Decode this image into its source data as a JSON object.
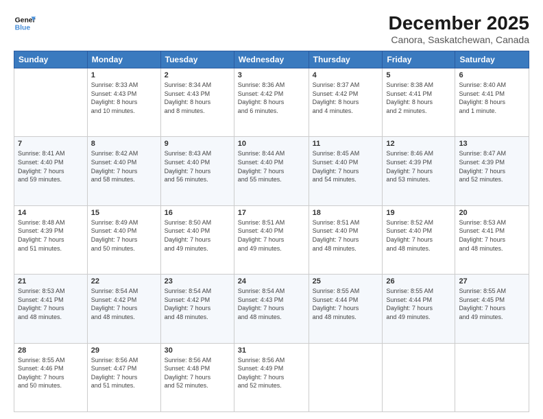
{
  "logo": {
    "line1": "General",
    "line2": "Blue"
  },
  "title": "December 2025",
  "subtitle": "Canora, Saskatchewan, Canada",
  "header_days": [
    "Sunday",
    "Monday",
    "Tuesday",
    "Wednesday",
    "Thursday",
    "Friday",
    "Saturday"
  ],
  "weeks": [
    [
      {
        "day": "",
        "content": ""
      },
      {
        "day": "1",
        "content": "Sunrise: 8:33 AM\nSunset: 4:43 PM\nDaylight: 8 hours\nand 10 minutes."
      },
      {
        "day": "2",
        "content": "Sunrise: 8:34 AM\nSunset: 4:43 PM\nDaylight: 8 hours\nand 8 minutes."
      },
      {
        "day": "3",
        "content": "Sunrise: 8:36 AM\nSunset: 4:42 PM\nDaylight: 8 hours\nand 6 minutes."
      },
      {
        "day": "4",
        "content": "Sunrise: 8:37 AM\nSunset: 4:42 PM\nDaylight: 8 hours\nand 4 minutes."
      },
      {
        "day": "5",
        "content": "Sunrise: 8:38 AM\nSunset: 4:41 PM\nDaylight: 8 hours\nand 2 minutes."
      },
      {
        "day": "6",
        "content": "Sunrise: 8:40 AM\nSunset: 4:41 PM\nDaylight: 8 hours\nand 1 minute."
      }
    ],
    [
      {
        "day": "7",
        "content": "Sunrise: 8:41 AM\nSunset: 4:40 PM\nDaylight: 7 hours\nand 59 minutes."
      },
      {
        "day": "8",
        "content": "Sunrise: 8:42 AM\nSunset: 4:40 PM\nDaylight: 7 hours\nand 58 minutes."
      },
      {
        "day": "9",
        "content": "Sunrise: 8:43 AM\nSunset: 4:40 PM\nDaylight: 7 hours\nand 56 minutes."
      },
      {
        "day": "10",
        "content": "Sunrise: 8:44 AM\nSunset: 4:40 PM\nDaylight: 7 hours\nand 55 minutes."
      },
      {
        "day": "11",
        "content": "Sunrise: 8:45 AM\nSunset: 4:40 PM\nDaylight: 7 hours\nand 54 minutes."
      },
      {
        "day": "12",
        "content": "Sunrise: 8:46 AM\nSunset: 4:39 PM\nDaylight: 7 hours\nand 53 minutes."
      },
      {
        "day": "13",
        "content": "Sunrise: 8:47 AM\nSunset: 4:39 PM\nDaylight: 7 hours\nand 52 minutes."
      }
    ],
    [
      {
        "day": "14",
        "content": "Sunrise: 8:48 AM\nSunset: 4:39 PM\nDaylight: 7 hours\nand 51 minutes."
      },
      {
        "day": "15",
        "content": "Sunrise: 8:49 AM\nSunset: 4:40 PM\nDaylight: 7 hours\nand 50 minutes."
      },
      {
        "day": "16",
        "content": "Sunrise: 8:50 AM\nSunset: 4:40 PM\nDaylight: 7 hours\nand 49 minutes."
      },
      {
        "day": "17",
        "content": "Sunrise: 8:51 AM\nSunset: 4:40 PM\nDaylight: 7 hours\nand 49 minutes."
      },
      {
        "day": "18",
        "content": "Sunrise: 8:51 AM\nSunset: 4:40 PM\nDaylight: 7 hours\nand 48 minutes."
      },
      {
        "day": "19",
        "content": "Sunrise: 8:52 AM\nSunset: 4:40 PM\nDaylight: 7 hours\nand 48 minutes."
      },
      {
        "day": "20",
        "content": "Sunrise: 8:53 AM\nSunset: 4:41 PM\nDaylight: 7 hours\nand 48 minutes."
      }
    ],
    [
      {
        "day": "21",
        "content": "Sunrise: 8:53 AM\nSunset: 4:41 PM\nDaylight: 7 hours\nand 48 minutes."
      },
      {
        "day": "22",
        "content": "Sunrise: 8:54 AM\nSunset: 4:42 PM\nDaylight: 7 hours\nand 48 minutes."
      },
      {
        "day": "23",
        "content": "Sunrise: 8:54 AM\nSunset: 4:42 PM\nDaylight: 7 hours\nand 48 minutes."
      },
      {
        "day": "24",
        "content": "Sunrise: 8:54 AM\nSunset: 4:43 PM\nDaylight: 7 hours\nand 48 minutes."
      },
      {
        "day": "25",
        "content": "Sunrise: 8:55 AM\nSunset: 4:44 PM\nDaylight: 7 hours\nand 48 minutes."
      },
      {
        "day": "26",
        "content": "Sunrise: 8:55 AM\nSunset: 4:44 PM\nDaylight: 7 hours\nand 49 minutes."
      },
      {
        "day": "27",
        "content": "Sunrise: 8:55 AM\nSunset: 4:45 PM\nDaylight: 7 hours\nand 49 minutes."
      }
    ],
    [
      {
        "day": "28",
        "content": "Sunrise: 8:55 AM\nSunset: 4:46 PM\nDaylight: 7 hours\nand 50 minutes."
      },
      {
        "day": "29",
        "content": "Sunrise: 8:56 AM\nSunset: 4:47 PM\nDaylight: 7 hours\nand 51 minutes."
      },
      {
        "day": "30",
        "content": "Sunrise: 8:56 AM\nSunset: 4:48 PM\nDaylight: 7 hours\nand 52 minutes."
      },
      {
        "day": "31",
        "content": "Sunrise: 8:56 AM\nSunset: 4:49 PM\nDaylight: 7 hours\nand 52 minutes."
      },
      {
        "day": "",
        "content": ""
      },
      {
        "day": "",
        "content": ""
      },
      {
        "day": "",
        "content": ""
      }
    ]
  ],
  "accent_color": "#3a7abf"
}
